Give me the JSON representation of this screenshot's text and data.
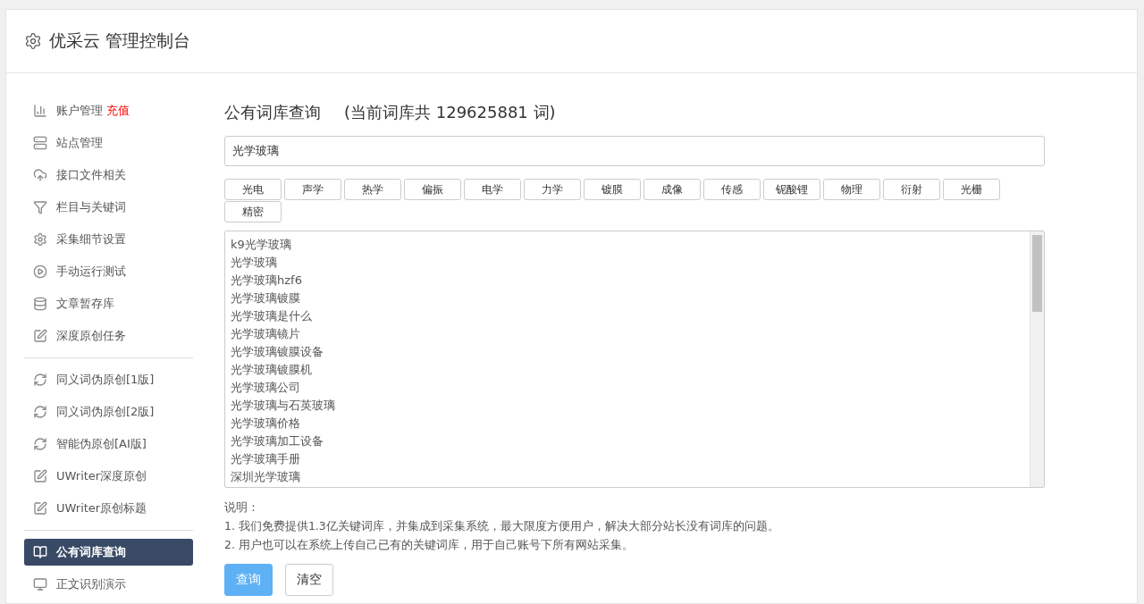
{
  "header": {
    "title": "优采云 管理控制台"
  },
  "sidebar": {
    "groups": [
      {
        "items": [
          {
            "label": "账户管理",
            "badge": "充值",
            "kind": "chart",
            "selected": false
          },
          {
            "label": "站点管理",
            "kind": "server",
            "selected": false
          },
          {
            "label": "接口文件相关",
            "kind": "cloud",
            "selected": false
          },
          {
            "label": "栏目与关键词",
            "kind": "filter",
            "selected": false
          },
          {
            "label": "采集细节设置",
            "kind": "gears",
            "selected": false
          },
          {
            "label": "手动运行测试",
            "kind": "play",
            "selected": false
          },
          {
            "label": "文章暂存库",
            "kind": "database",
            "selected": false
          },
          {
            "label": "深度原创任务",
            "kind": "edit",
            "selected": false
          }
        ]
      },
      {
        "items": [
          {
            "label": "同义词伪原创[1版]",
            "kind": "refresh",
            "selected": false
          },
          {
            "label": "同义词伪原创[2版]",
            "kind": "refresh",
            "selected": false
          },
          {
            "label": "智能伪原创[AI版]",
            "kind": "refresh",
            "selected": false
          },
          {
            "label": "UWriter深度原创",
            "kind": "edit",
            "selected": false
          },
          {
            "label": "UWriter原创标题",
            "kind": "edit",
            "selected": false
          }
        ]
      },
      {
        "items": [
          {
            "label": "公有词库查询",
            "kind": "book",
            "selected": true
          },
          {
            "label": "正文识别演示",
            "kind": "monitor",
            "selected": false
          }
        ]
      }
    ]
  },
  "main": {
    "title": "公有词库查询",
    "count": "(当前词库共 129625881 词)",
    "search": {
      "value": "光学玻璃"
    },
    "tags": [
      "光电",
      "声学",
      "热学",
      "偏振",
      "电学",
      "力学",
      "镀膜",
      "成像",
      "传感",
      "铌酸锂",
      "物理",
      "衍射",
      "光栅",
      "精密"
    ],
    "results": [
      "k9光学玻璃",
      "光学玻璃",
      "光学玻璃hzf6",
      "光学玻璃镀膜",
      "光学玻璃是什么",
      "光学玻璃镜片",
      "光学玻璃镀膜设备",
      "光学玻璃镀膜机",
      "光学玻璃公司",
      "光学玻璃与石英玻璃",
      "光学玻璃价格",
      "光学玻璃加工设备",
      "光学玻璃手册",
      "深圳光学玻璃"
    ],
    "notes_title": "说明：",
    "notes": [
      "1. 我们免费提供1.3亿关键词库，并集成到采集系统，最大限度方便用户，解决大部分站长没有词库的问题。",
      "2. 用户也可以在系统上传自己已有的关键词库，用于自己账号下所有网站采集。"
    ],
    "buttons": [
      {
        "label": "查询",
        "kind": "primary"
      },
      {
        "label": "清空",
        "kind": "default"
      }
    ]
  }
}
